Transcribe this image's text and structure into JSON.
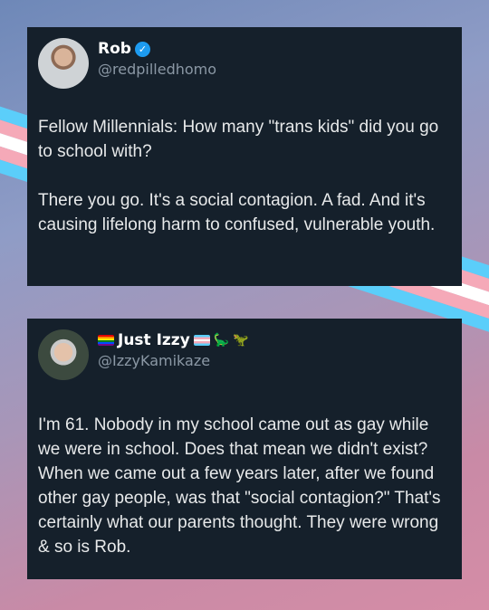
{
  "colors": {
    "card_bg": "#15202b",
    "text": "#e7e9ea",
    "muted": "#8b98a5",
    "verified": "#1d9bf0",
    "trans_blue": "#5bcefa",
    "trans_pink": "#f5a9b8"
  },
  "tweets": [
    {
      "name": "Rob",
      "verified": true,
      "handle": "@redpilledhomo",
      "paragraphs": [
        "Fellow Millennials: How many \"trans kids\" did you go to school with?",
        "There you go. It's a social contagion. A fad. And it's causing lifelong harm to confused, vulnerable youth."
      ]
    },
    {
      "name": "Just Izzy",
      "name_emojis": [
        "rainbow-flag",
        "transgender-flag",
        "sauropod",
        "t-rex"
      ],
      "handle": "@IzzyKamikaze",
      "paragraphs": [
        "I'm 61. Nobody in my school came out as gay while we were in school. Does that mean we didn't exist? When we came out a few years later, after we found other gay people, was that \"social contagion?\" That's certainly what our parents thought. They were wrong & so is Rob."
      ]
    }
  ]
}
